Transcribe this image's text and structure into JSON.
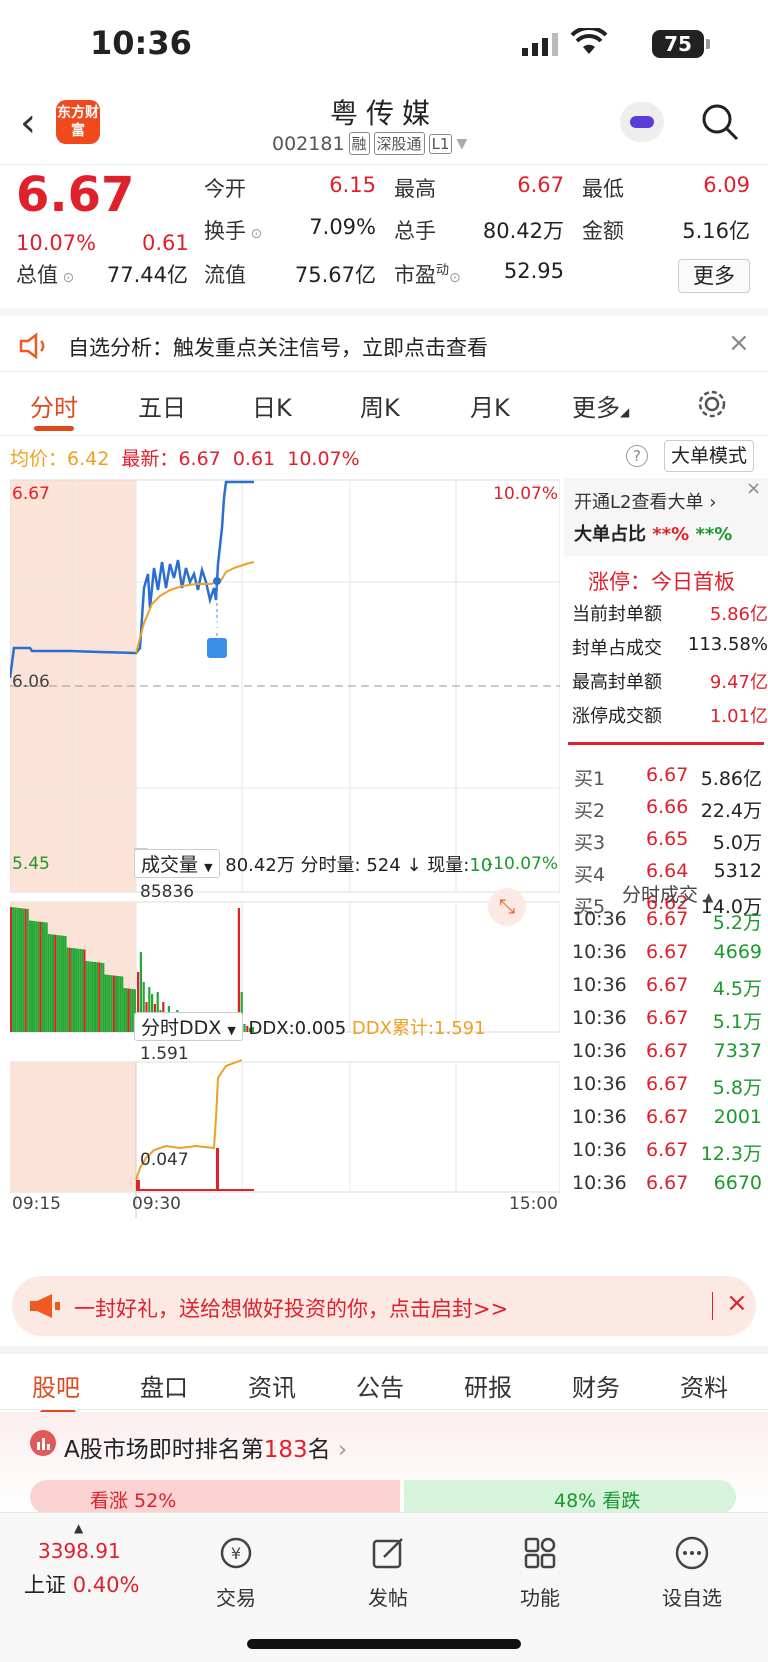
{
  "status": {
    "time": "10:36",
    "battery": "75"
  },
  "header": {
    "logo": "东方财富",
    "name": "粤传媒",
    "code": "002181",
    "tags": [
      "融",
      "深股通",
      "L1"
    ]
  },
  "quote": {
    "price": "6.67",
    "pct": "10.07%",
    "change": "0.61",
    "fields": [
      {
        "label": "今开",
        "value": "6.15",
        "color": "#e0202a"
      },
      {
        "label": "最高",
        "value": "6.67",
        "color": "#e0202a"
      },
      {
        "label": "最低",
        "value": "6.09",
        "color": "#e0202a"
      },
      {
        "label": "换手",
        "value": "7.09%",
        "color": "#222222"
      },
      {
        "label": "总手",
        "value": "80.42万",
        "color": "#222222"
      },
      {
        "label": "金额",
        "value": "5.16亿",
        "color": "#222222"
      },
      {
        "label": "总值",
        "value": "77.44亿",
        "color": "#222222"
      },
      {
        "label": "流值",
        "value": "75.67亿",
        "color": "#222222"
      },
      {
        "label": "市盈",
        "value": "52.95",
        "color": "#222222"
      }
    ],
    "pe_superscript": "动",
    "more": "更多"
  },
  "notice": {
    "text": "自选分析：触发重点关注信号，立即点击查看"
  },
  "tabs": [
    "分时",
    "五日",
    "日K",
    "周K",
    "月K",
    "更多"
  ],
  "infoline": {
    "avg_label": "均价：",
    "avg": "6.42",
    "latest_label": "最新：",
    "latest": "6.67",
    "change": "0.61",
    "pct": "10.07%",
    "bigorder_btn": "大单模式"
  },
  "chart": {
    "y_top": "6.67",
    "y_mid": "6.06",
    "y_bot": "5.45",
    "pct_top": "10.07%",
    "pct_bot": "-10.07%",
    "marker": "S",
    "volume_dropdown": "成交量",
    "volume_info": {
      "total": "80.42万",
      "minute_label": "分时量:",
      "minute": "524",
      "current_label": "现量:",
      "current": "10"
    },
    "volume_max": "85836",
    "ddx_dropdown": "分时DDX",
    "ddx_label": "DDX:",
    "ddx": "0.005",
    "ddx_cum_label": "DDX累计:",
    "ddx_cum": "1.591",
    "ddx_top": "1.591",
    "ddx_bot": "0.047",
    "times": [
      "09:15",
      "09:30",
      "15:00"
    ]
  },
  "right_panel": {
    "l2": "开通L2查看大单",
    "bigratio_label": "大单占比",
    "bigratio_1": "**%",
    "bigratio_2": "**%",
    "limit_title": "涨停：今日首板",
    "limit_rows": [
      {
        "label": "当前封单额",
        "value": "5.86亿"
      },
      {
        "label": "封单占成交",
        "value": "113.58%"
      },
      {
        "label": "最高封单额",
        "value": "9.47亿"
      },
      {
        "label": "涨停成交额",
        "value": "1.01亿"
      }
    ],
    "orderbook": [
      {
        "label": "买1",
        "price": "6.67",
        "vol": "5.86亿"
      },
      {
        "label": "买2",
        "price": "6.66",
        "vol": "22.4万"
      },
      {
        "label": "买3",
        "price": "6.65",
        "vol": "5.0万"
      },
      {
        "label": "买4",
        "price": "6.64",
        "vol": "5312"
      },
      {
        "label": "买5",
        "price": "6.62",
        "vol": "14.0万"
      }
    ],
    "ticks_title": "分时成交",
    "ticks": [
      {
        "t": "10:36",
        "p": "6.67",
        "v": "5.2万"
      },
      {
        "t": "10:36",
        "p": "6.67",
        "v": "4669"
      },
      {
        "t": "10:36",
        "p": "6.67",
        "v": "4.5万"
      },
      {
        "t": "10:36",
        "p": "6.67",
        "v": "5.1万"
      },
      {
        "t": "10:36",
        "p": "6.67",
        "v": "7337"
      },
      {
        "t": "10:36",
        "p": "6.67",
        "v": "5.8万"
      },
      {
        "t": "10:36",
        "p": "6.67",
        "v": "2001"
      },
      {
        "t": "10:36",
        "p": "6.67",
        "v": "12.3万"
      },
      {
        "t": "10:36",
        "p": "6.67",
        "v": "6670"
      }
    ]
  },
  "promo": {
    "text": "一封好礼，送给想做好投资的你，点击启封>>"
  },
  "bottom_tabs": [
    "股吧",
    "盘口",
    "资讯",
    "公告",
    "研报",
    "财务",
    "资料"
  ],
  "rank": {
    "prefix": "A股市场即时排名第",
    "num": "183",
    "suffix": "名",
    "up": "看涨 52%",
    "down": "48% 看跌"
  },
  "bottom_nav": {
    "index_value": "3398.91",
    "index_name": "上证",
    "index_pct": "0.40%",
    "items": [
      "交易",
      "发帖",
      "功能",
      "设自选"
    ]
  }
}
